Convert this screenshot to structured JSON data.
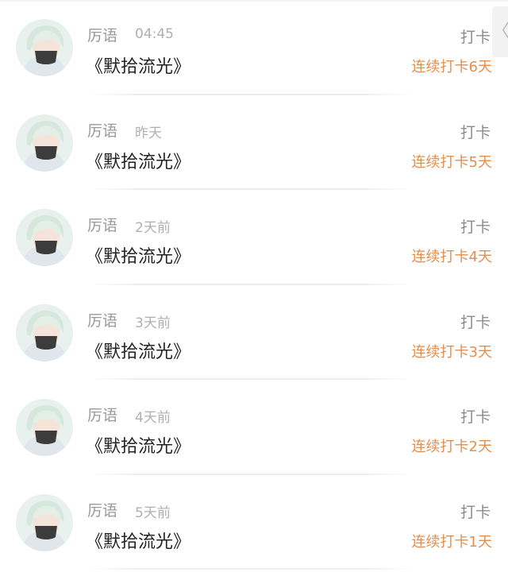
{
  "accent_color": "#e48e4f",
  "collapse_icon": "chevron-left-icon",
  "collapse_glyph": "〈",
  "entries": [
    {
      "user": "厉语",
      "time": "04:45",
      "title": "《默拾流光》",
      "action": "打卡",
      "streak": "连续打卡6天"
    },
    {
      "user": "厉语",
      "time": "昨天",
      "title": "《默拾流光》",
      "action": "打卡",
      "streak": "连续打卡5天"
    },
    {
      "user": "厉语",
      "time": "2天前",
      "title": "《默拾流光》",
      "action": "打卡",
      "streak": "连续打卡4天"
    },
    {
      "user": "厉语",
      "time": "3天前",
      "title": "《默拾流光》",
      "action": "打卡",
      "streak": "连续打卡3天"
    },
    {
      "user": "厉语",
      "time": "4天前",
      "title": "《默拾流光》",
      "action": "打卡",
      "streak": "连续打卡2天"
    },
    {
      "user": "厉语",
      "time": "5天前",
      "title": "《默拾流光》",
      "action": "打卡",
      "streak": "连续打卡1天"
    }
  ]
}
